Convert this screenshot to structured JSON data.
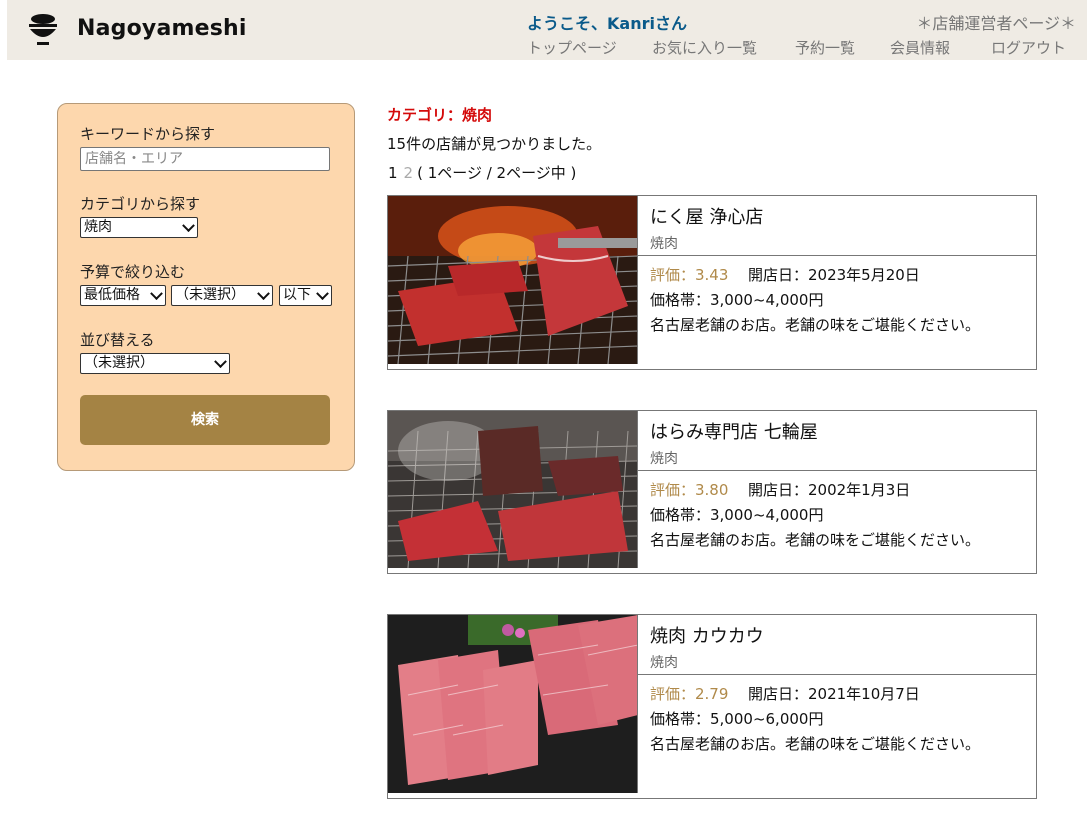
{
  "header": {
    "brand": "Nagoyameshi",
    "welcome": "ようこそ、Kanriさん",
    "owner_link": "＊店舗運営者ページ＊",
    "nav": [
      "トップページ",
      "お気に入り一覧",
      "予約一覧",
      "会員情報",
      "ログアウト"
    ]
  },
  "sidebar": {
    "keyword_label": "キーワードから探す",
    "keyword_placeholder": "店舗名・エリア",
    "category_label": "カテゴリから探す",
    "category_value": "焼肉",
    "budget_label": "予算で絞り込む",
    "budget_type": "最低価格",
    "budget_value": "（未選択）",
    "budget_cond": "以下",
    "sort_label": "並び替える",
    "sort_value": "（未選択）",
    "search_button": "検索"
  },
  "main": {
    "category_title": "カテゴリ：焼肉",
    "found_text": "15件の店舗が見つかりました。",
    "pager": {
      "page1": "1",
      "page2": "2",
      "info": "( 1ページ / 2ページ中 )"
    },
    "shops": [
      {
        "name": "にく屋 浄心店",
        "category": "焼肉",
        "rating": "評価：3.43",
        "opened": "開店日：2023年5月20日",
        "price": "価格帯：3,000~4,000円",
        "description": "名古屋老舗のお店。老舗の味をご堪能ください。"
      },
      {
        "name": "はらみ専門店 七輪屋",
        "category": "焼肉",
        "rating": "評価：3.80",
        "opened": "開店日：2002年1月3日",
        "price": "価格帯：3,000~4,000円",
        "description": "名古屋老舗のお店。老舗の味をご堪能ください。"
      },
      {
        "name": "焼肉 カウカウ",
        "category": "焼肉",
        "rating": "評価：2.79",
        "opened": "開店日：2021年10月7日",
        "price": "価格帯：5,000~6,000円",
        "description": "名古屋老舗のお店。老舗の味をご堪能ください。"
      }
    ]
  }
}
